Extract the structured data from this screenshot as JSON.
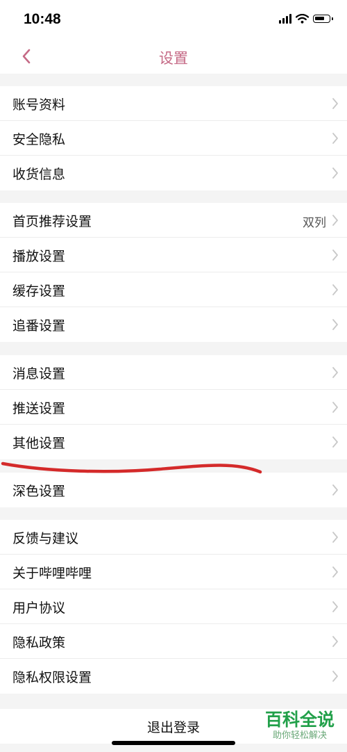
{
  "status_bar": {
    "time": "10:48"
  },
  "nav": {
    "title": "设置"
  },
  "groups": [
    {
      "items": [
        {
          "label": "账号资料"
        },
        {
          "label": "安全隐私"
        },
        {
          "label": "收货信息"
        }
      ]
    },
    {
      "items": [
        {
          "label": "首页推荐设置",
          "value": "双列"
        },
        {
          "label": "播放设置"
        },
        {
          "label": "缓存设置"
        },
        {
          "label": "追番设置"
        }
      ]
    },
    {
      "items": [
        {
          "label": "消息设置"
        },
        {
          "label": "推送设置"
        },
        {
          "label": "其他设置"
        }
      ]
    },
    {
      "items": [
        {
          "label": "深色设置"
        }
      ]
    },
    {
      "items": [
        {
          "label": "反馈与建议"
        },
        {
          "label": "关于哔哩哔哩"
        },
        {
          "label": "用户协议"
        },
        {
          "label": "隐私政策"
        },
        {
          "label": "隐私权限设置"
        }
      ]
    }
  ],
  "logout": {
    "label": "退出登录"
  },
  "watermark": {
    "main": "百科全说",
    "sub": "助你轻松解决"
  },
  "colors": {
    "accent": "#c56a86",
    "annotation": "#d42a2a",
    "watermark": "#22a04a"
  }
}
